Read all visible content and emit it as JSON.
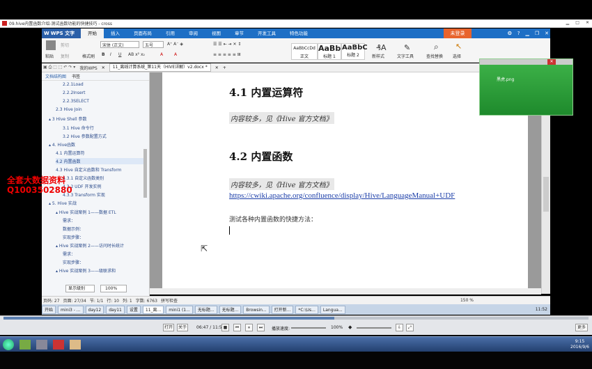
{
  "player_title": "09.hive内置函数介绍-测试函数功能的快捷技巧 - cross",
  "wps": {
    "logo": "WPS 文字",
    "tabs": [
      "开始",
      "插入",
      "页面布局",
      "引用",
      "审阅",
      "视图",
      "章节",
      "开发工具",
      "特色功能"
    ],
    "login": "未登录",
    "ribbon": {
      "paste": "粘贴",
      "cut": "剪切",
      "copy": "复制",
      "format_painter": "格式刷",
      "font": "宋体 (正文)",
      "size": "五号",
      "styles": [
        {
          "preview": "AaBbCcDd",
          "label": "正文"
        },
        {
          "preview": "AaBb",
          "label": "标题 1"
        },
        {
          "preview": "AaBbC",
          "label": "标题 2"
        }
      ],
      "new_style": "新样式",
      "text_tools": "文字工具",
      "find_replace": "查找替换",
      "select": "选择"
    },
    "tabbar": {
      "home": "我的WPS",
      "doc": "11_离线计算系统_第11天（HIVE详解）v2.docx *"
    },
    "panel": {
      "tabs": [
        "文档结构图",
        "书签"
      ],
      "zoom_mode": "显示级别",
      "zoom": "100%"
    },
    "outline": [
      {
        "text": "2.2.1Load",
        "indent": 2
      },
      {
        "text": "2.2.2Insert",
        "indent": 2
      },
      {
        "text": "2.2.3SELECT",
        "indent": 2
      },
      {
        "text": "2.3 Hive Join",
        "indent": 1
      },
      {
        "text": "▴ 3 Hive Shell 参数",
        "indent": 0
      },
      {
        "text": "3.1 Hive 命令行",
        "indent": 2
      },
      {
        "text": "3.2 Hive 参数配置方式",
        "indent": 2
      },
      {
        "text": "▴ 4. Hive函数",
        "indent": 0
      },
      {
        "text": "4.1 内置运算符",
        "indent": 1
      },
      {
        "text": "4.2 内置函数",
        "indent": 1
      },
      {
        "text": "4.3 Hive 自定义函数和 Transform",
        "indent": 1
      },
      {
        "text": "4.3.1 自定义函数类别",
        "indent": 2
      },
      {
        "text": "4.3.2 UDF 开发实例",
        "indent": 2
      },
      {
        "text": "4.3.3 Transform 实现",
        "indent": 2
      },
      {
        "text": "▴ 5. Hive 实战",
        "indent": 0
      },
      {
        "text": "▴ Hive 实战案例 1——数据 ETL",
        "indent": 1
      },
      {
        "text": "需求：",
        "indent": 2
      },
      {
        "text": "数据示例：",
        "indent": 2
      },
      {
        "text": "实现步骤：",
        "indent": 2
      },
      {
        "text": "▴ Hive 实战案例 2——访问时长统计",
        "indent": 1
      },
      {
        "text": "需求：",
        "indent": 2
      },
      {
        "text": "实现步骤：",
        "indent": 2
      },
      {
        "text": "▴ Hive 实战案例 3——级联求和",
        "indent": 1
      }
    ],
    "doc": {
      "h41": "4.1 内置运算符",
      "q1": "内容较多，见《Hive 官方文档》",
      "h42": "4.2 内置函数",
      "q2": "内容较多，见《Hive 官方文档》",
      "url": "https://cwiki.apache.org/confluence/display/Hive/LanguageManual+UDF",
      "test": "测试各种内置函数的快捷方法："
    },
    "status": {
      "page": "页码: 27",
      "pages": "页面: 27/34",
      "section": "节: 1/1",
      "row": "行: 10",
      "col": "列: 1",
      "words": "字数: 6763",
      "spell": "拼写检查",
      "zoom": "150 %"
    },
    "taskbar": [
      "开始",
      "mini3 - ...",
      "day12",
      "day11",
      "设置",
      "11_离...",
      "mini1 (1...",
      "无标题...",
      "无标题...",
      "Browsin...",
      "打开新...",
      "*C:\\Us...",
      "Langua..."
    ],
    "clock": "11:52"
  },
  "popup_file": "黑虎.png",
  "watermark": [
    "全套大数据资料",
    "Q1003502880"
  ],
  "player": {
    "open": "打开",
    "about": "关于",
    "time": "06:47 / 11:59",
    "speed_label": "播放速度:",
    "speed": "100%",
    "more": "更多"
  },
  "win_clock": {
    "time": "9:15",
    "date": "2016/9/6"
  }
}
